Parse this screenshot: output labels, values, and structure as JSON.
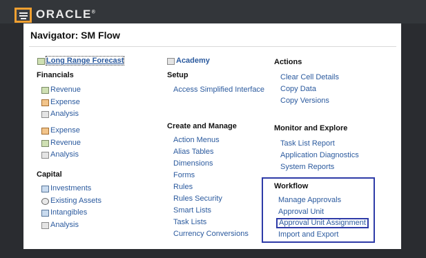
{
  "header": {
    "logo_text": "ORACLE",
    "logo_mark": "®"
  },
  "navigator": {
    "title": "Navigator: SM Flow",
    "column1": {
      "top_link": {
        "label": "Long Range Forecast",
        "icon": "chart-icon"
      },
      "financials": {
        "title": "Financials",
        "items": [
          {
            "label": "Revenue",
            "icon": "cube-icon"
          },
          {
            "label": "Expense",
            "icon": "chart-icon"
          },
          {
            "label": "Analysis",
            "icon": "table-icon"
          }
        ]
      },
      "group2": {
        "items": [
          {
            "label": "Expense",
            "icon": "chart-icon"
          },
          {
            "label": "Revenue",
            "icon": "cube-icon"
          },
          {
            "label": "Analysis",
            "icon": "table-icon"
          }
        ]
      },
      "capital": {
        "title": "Capital",
        "items": [
          {
            "label": "Investments",
            "icon": "bank-icon"
          },
          {
            "label": "Existing Assets",
            "icon": "asset-icon"
          },
          {
            "label": "Intangibles",
            "icon": "stack-icon"
          },
          {
            "label": "Analysis",
            "icon": "table-icon"
          }
        ]
      }
    },
    "column2": {
      "top_link": {
        "label": "Academy",
        "icon": "academy-icon"
      },
      "setup": {
        "title": "Setup",
        "items": [
          {
            "label": "Access Simplified Interface"
          }
        ]
      },
      "create_manage": {
        "title": "Create and Manage",
        "items": [
          {
            "label": "Action Menus"
          },
          {
            "label": "Alias Tables"
          },
          {
            "label": "Dimensions"
          },
          {
            "label": "Forms"
          },
          {
            "label": "Rules"
          },
          {
            "label": "Rules Security"
          },
          {
            "label": "Smart Lists"
          },
          {
            "label": "Task Lists"
          },
          {
            "label": "Currency Conversions"
          }
        ]
      }
    },
    "column3": {
      "actions": {
        "title": "Actions",
        "items": [
          {
            "label": "Clear Cell Details"
          },
          {
            "label": "Copy Data"
          },
          {
            "label": "Copy Versions"
          }
        ]
      },
      "monitor": {
        "title": "Monitor and Explore",
        "items": [
          {
            "label": "Task List Report"
          },
          {
            "label": "Application Diagnostics"
          },
          {
            "label": "System Reports"
          }
        ]
      },
      "workflow": {
        "title": "Workflow",
        "items": [
          {
            "label": "Manage Approvals"
          },
          {
            "label": "Approval Unit"
          },
          {
            "label": "Approval Unit Assignment"
          },
          {
            "label": "Import and Export"
          }
        ]
      }
    }
  },
  "colors": {
    "accent_highlight": "#f0a030",
    "selection_box": "#2d3aa7",
    "link": "#2b5a9e"
  }
}
